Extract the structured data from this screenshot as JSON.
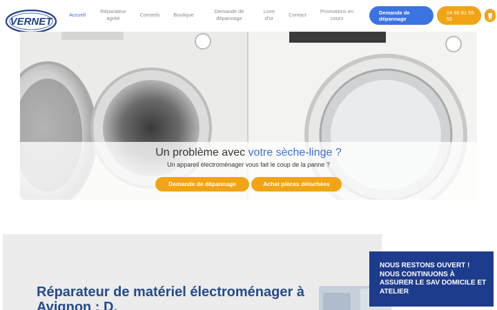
{
  "logo": {
    "text": "VERNET"
  },
  "nav": {
    "items": [
      {
        "label": "Accueil"
      },
      {
        "label": "Réparateur agréé"
      },
      {
        "label": "Conseils"
      },
      {
        "label": "Boutique"
      },
      {
        "label": "Demande de dépannage"
      },
      {
        "label": "Livre d'or"
      },
      {
        "label": "Contact"
      },
      {
        "label": "Promotions en cours"
      }
    ]
  },
  "header_buttons": {
    "request": "Demande de dépannage",
    "phone": "04 90 81 55 55",
    "cart_icon": "cart-icon"
  },
  "hero": {
    "title_prefix": "Un problème avec ",
    "title_accent": "votre sèche-linge ?",
    "subtitle": "Un appareil électroménager vous fait le coup de la panne ?",
    "button_repair": "Demande de dépannage",
    "button_parts": "Achat pièces détachées"
  },
  "section": {
    "title": "Réparateur de matériel électroménager à Avignon : D."
  },
  "notice": {
    "text": "NOUS RESTONS OUVERT ! NOUS CONTINUONS À ASSURER LE SAV DOMICILE ET ATELIER"
  },
  "colors": {
    "accent_blue": "#3b74e0",
    "accent_orange": "#f1a416",
    "navy": "#1e3c8c"
  }
}
